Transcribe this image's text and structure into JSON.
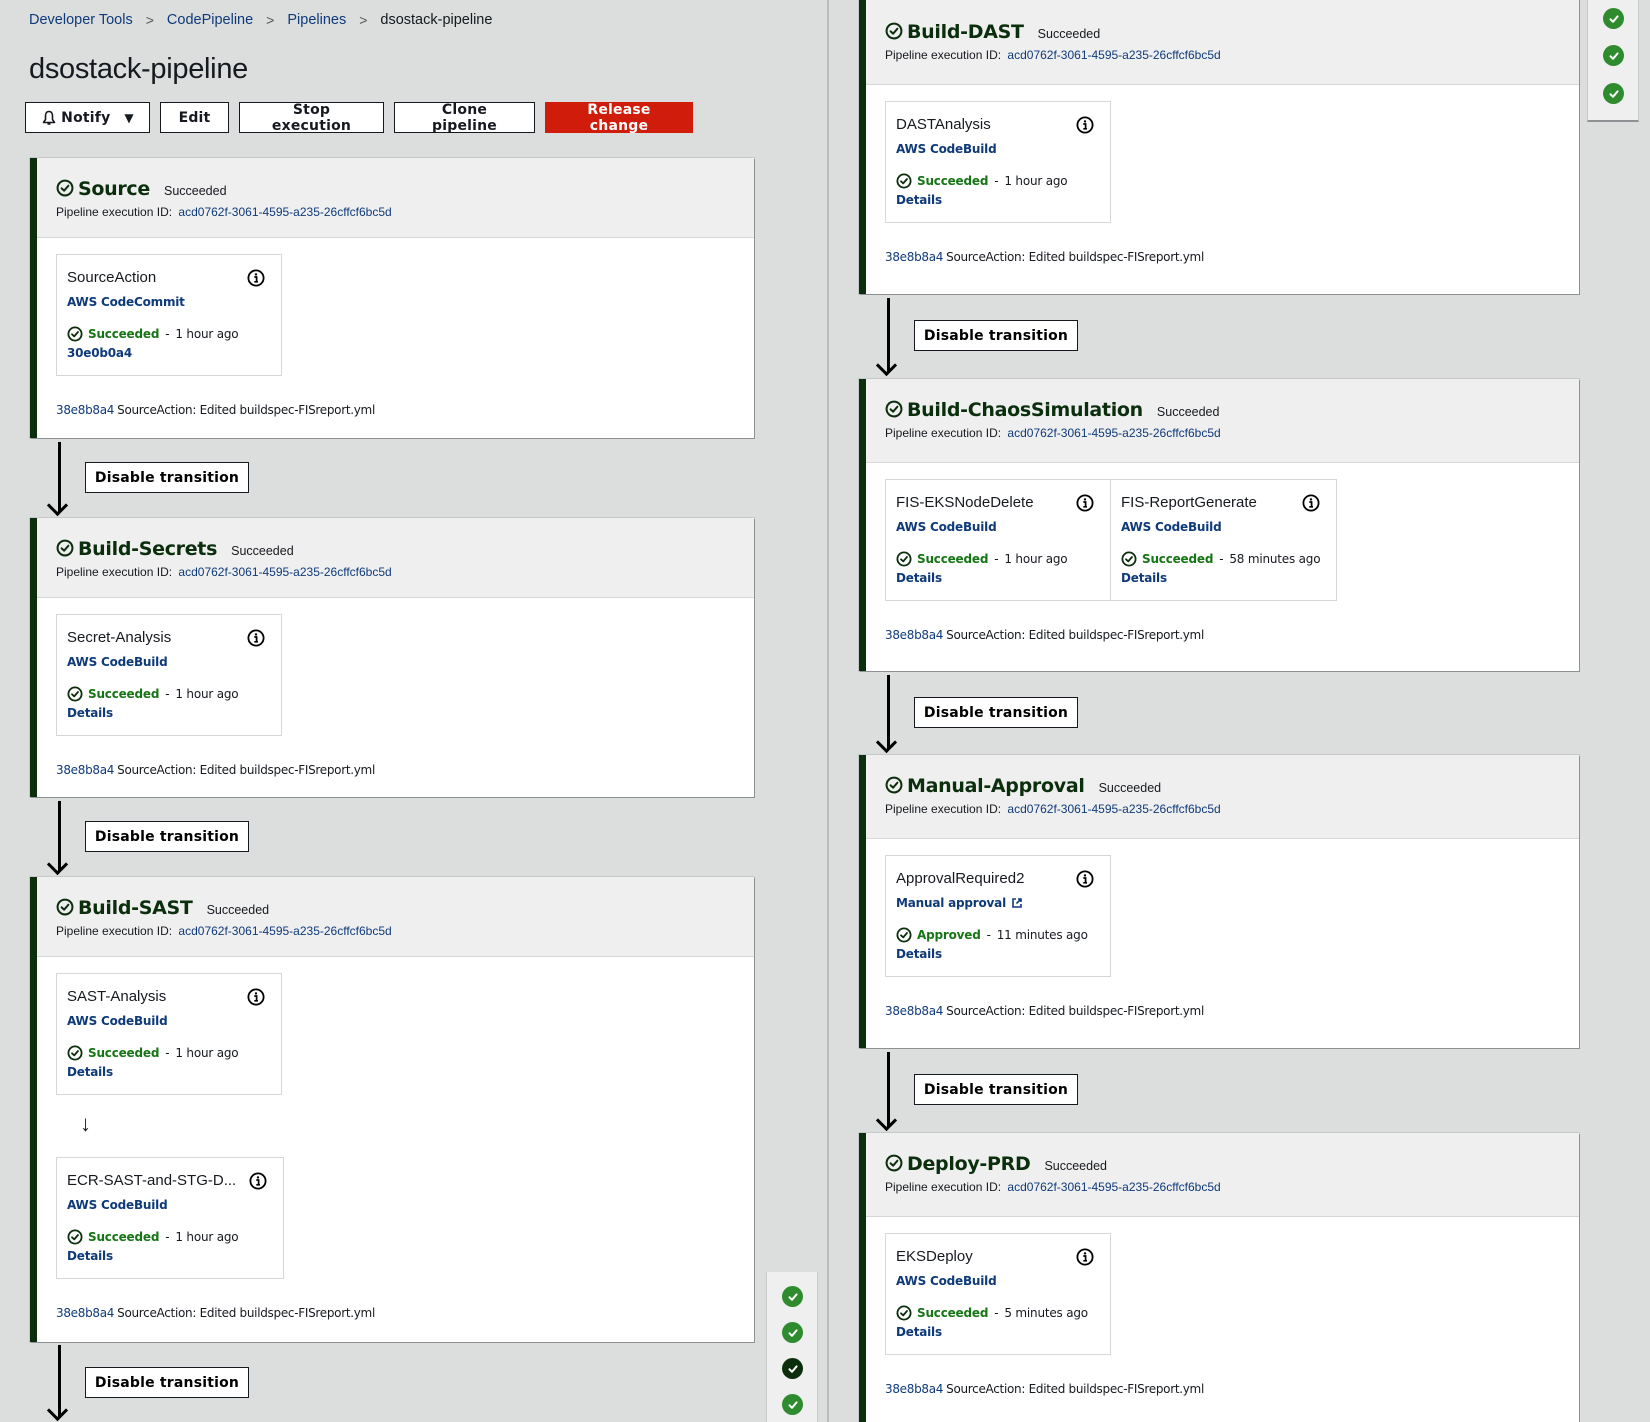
{
  "breadcrumb": [
    {
      "label": "Developer Tools"
    },
    {
      "label": "CodePipeline"
    },
    {
      "label": "Pipelines"
    },
    {
      "label": "dsostack-pipeline"
    }
  ],
  "page_title": "dsostack-pipeline",
  "toolbar": {
    "notify_label": "Notify",
    "edit_label": "Edit",
    "stop_label": "Stop execution",
    "clone_label": "Clone pipeline",
    "release_label": "Release change"
  },
  "colors": {
    "stage_accent": "#0b2e0c",
    "success": "#167514",
    "link": "#0f3a7a",
    "primary_button": "#d01d0b",
    "minimap_success": "#2e8b2e"
  },
  "transition_label": "Disable transition",
  "exec_label": "Pipeline execution ID:",
  "execution_id": "acd0762f-3061-4595-a235-26cffcf6bc5d",
  "commit": {
    "id": "38e8b8a4",
    "message": "SourceAction: Edited buildspec-FISreport.yml"
  },
  "stages": {
    "source": {
      "name": "Source",
      "status": "Succeeded",
      "actions": [
        {
          "name": "SourceAction",
          "provider": "AWS CodeCommit",
          "status": "Succeeded",
          "time": "1 hour ago",
          "link": "30e0b0a4"
        }
      ]
    },
    "secrets": {
      "name": "Build-Secrets",
      "status": "Succeeded",
      "actions": [
        {
          "name": "Secret-Analysis",
          "provider": "AWS CodeBuild",
          "status": "Succeeded",
          "time": "1 hour ago",
          "link": "Details"
        }
      ]
    },
    "sast": {
      "name": "Build-SAST",
      "status": "Succeeded",
      "actions": [
        {
          "name": "SAST-Analysis",
          "provider": "AWS CodeBuild",
          "status": "Succeeded",
          "time": "1 hour ago",
          "link": "Details"
        },
        {
          "name": "ECR-SAST-and-STG-D...",
          "provider": "AWS CodeBuild",
          "status": "Succeeded",
          "time": "1 hour ago",
          "link": "Details"
        }
      ]
    },
    "dast": {
      "name": "Build-DAST",
      "status": "Succeeded",
      "actions": [
        {
          "name": "DASTAnalysis",
          "provider": "AWS CodeBuild",
          "status": "Succeeded",
          "time": "1 hour ago",
          "link": "Details"
        }
      ]
    },
    "chaos": {
      "name": "Build-ChaosSimulation",
      "status": "Succeeded",
      "actions": [
        {
          "name": "FIS-EKSNodeDelete",
          "provider": "AWS CodeBuild",
          "status": "Succeeded",
          "time": "1 hour ago",
          "link": "Details"
        },
        {
          "name": "FIS-ReportGenerate",
          "provider": "AWS CodeBuild",
          "status": "Succeeded",
          "time": "58 minutes ago",
          "link": "Details"
        }
      ]
    },
    "approval": {
      "name": "Manual-Approval",
      "status": "Succeeded",
      "actions": [
        {
          "name": "ApprovalRequired2",
          "provider": "Manual approval",
          "status": "Approved",
          "time": "11 minutes ago",
          "link": "Details"
        }
      ]
    },
    "deploy": {
      "name": "Deploy-PRD",
      "status": "Succeeded",
      "actions": [
        {
          "name": "EKSDeploy",
          "provider": "AWS CodeBuild",
          "status": "Succeeded",
          "time": "5 minutes ago",
          "link": "Details"
        }
      ]
    }
  },
  "minimap_left": [
    "succeeded",
    "succeeded",
    "succeeded-current",
    "succeeded"
  ],
  "minimap_right": [
    "succeeded",
    "succeeded",
    "succeeded"
  ]
}
